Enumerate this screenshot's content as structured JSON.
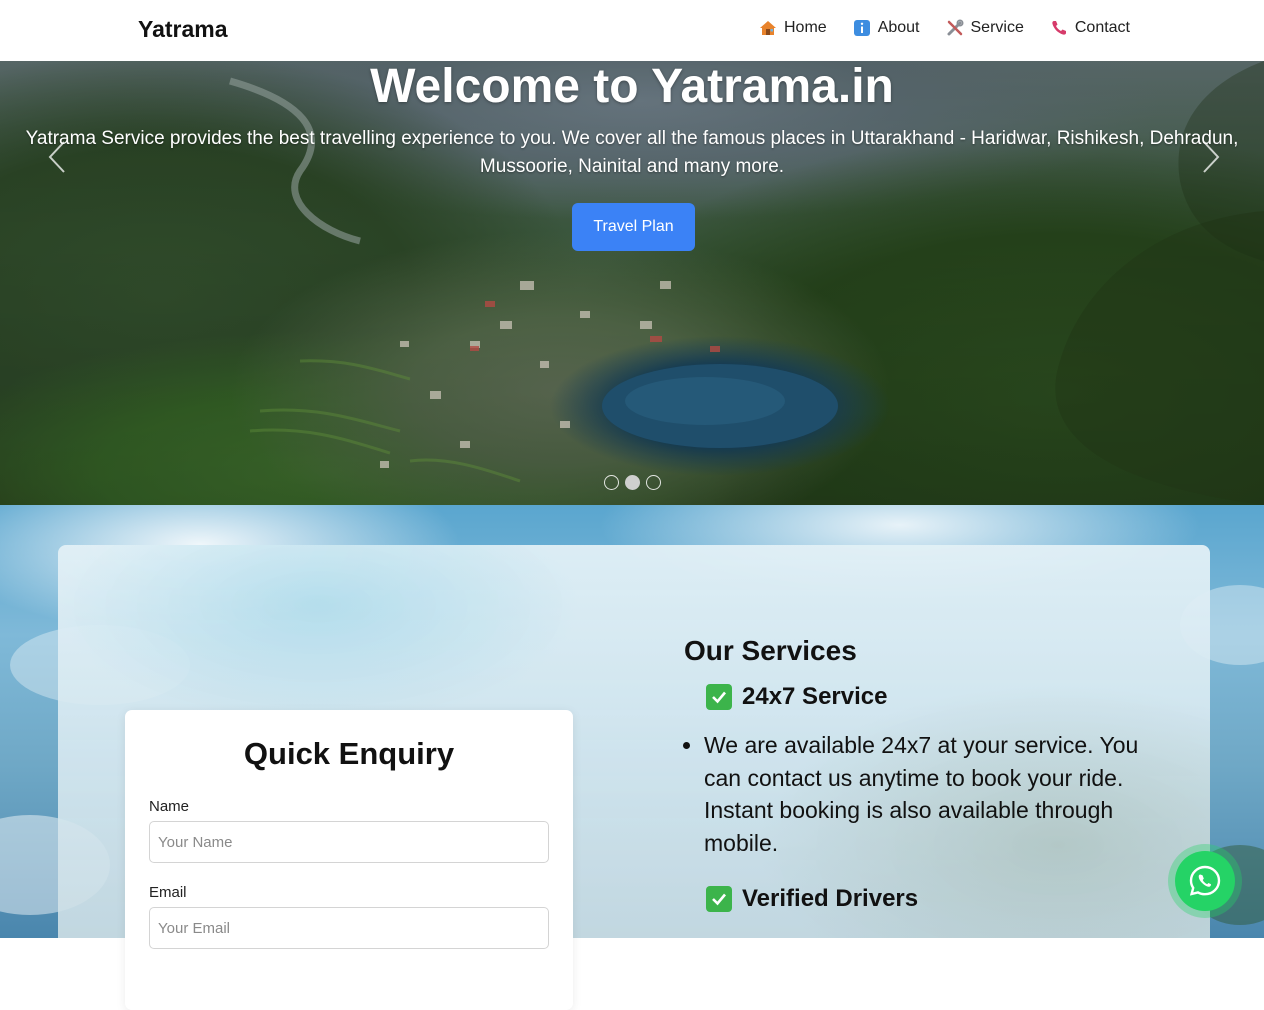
{
  "nav": {
    "brand": "Yatrama",
    "links": [
      {
        "label": "Home",
        "icon": "house-icon"
      },
      {
        "label": "About",
        "icon": "info-icon"
      },
      {
        "label": "Service",
        "icon": "tools-icon"
      },
      {
        "label": "Contact",
        "icon": "phone-icon"
      }
    ]
  },
  "hero": {
    "title": "Welcome to Yatrama.in",
    "text_line1": "Yatrama Service provides the best travelling experience to you. We cover all the famous places in Uttarakhand - Haridwar, Rishikesh, Dehradun,",
    "text_line2": "Mussoorie, Nainital and many more.",
    "button_label": "Travel Plan",
    "slides": 3,
    "active_slide": 2
  },
  "enquiry": {
    "title": "Quick Enquiry",
    "name_label": "Name",
    "name_placeholder": "Your Name",
    "email_label": "Email",
    "email_placeholder": "Your Email"
  },
  "services": {
    "heading": "Our Services",
    "items": [
      {
        "title": "24x7 Service",
        "description": "We are available 24x7 at your service. You can contact us anytime to book your ride. Instant booking is also available through mobile."
      },
      {
        "title": "Verified Drivers",
        "description": ""
      }
    ]
  },
  "colors": {
    "primary_button": "#3b82f6",
    "whatsapp": "#25d366",
    "check": "#3cb44b"
  }
}
